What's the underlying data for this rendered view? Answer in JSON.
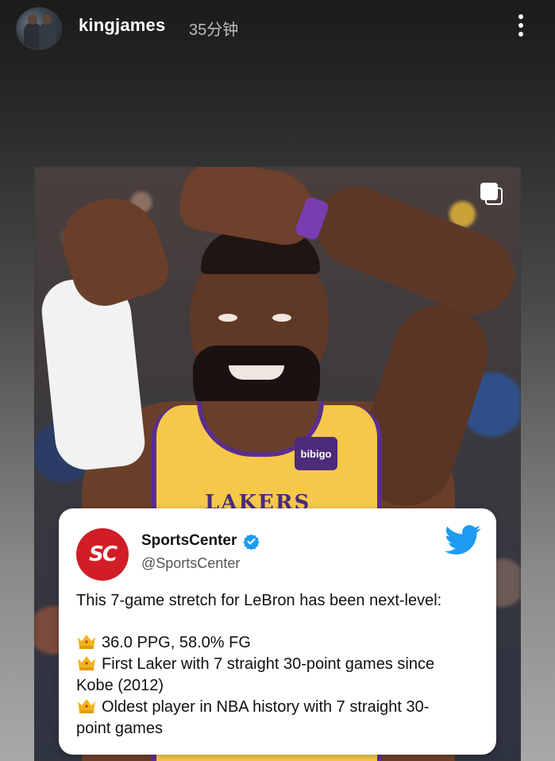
{
  "story_header": {
    "username": "kingjames",
    "timestamp": "35分钟"
  },
  "tweet": {
    "display_name": "SportsCenter",
    "handle": "@SportsCenter",
    "logo_text": "SC",
    "intro": "This 7-game stretch for LeBron has been next-level:",
    "bullets": [
      "36.0 PPG, 58.0% FG",
      "First Laker with 7 straight 30-point games since",
      "Kobe (2012)",
      "Oldest player in NBA history with 7 straight 30-",
      "point games"
    ]
  },
  "image": {
    "jersey_text": "LAKERS",
    "sponsor_text": "bibigo"
  },
  "colors": {
    "espn_red": "#d11d25",
    "twitter_blue": "#1d9bf0",
    "lakers_gold": "#f6c84a",
    "lakers_purple": "#5a2e8a"
  },
  "icons": {
    "more": "more-vertical-icon",
    "multi_image": "multiple-images-icon",
    "verified": "verified-badge-icon",
    "twitter": "twitter-bird-icon",
    "crown": "crown-emoji-icon"
  }
}
